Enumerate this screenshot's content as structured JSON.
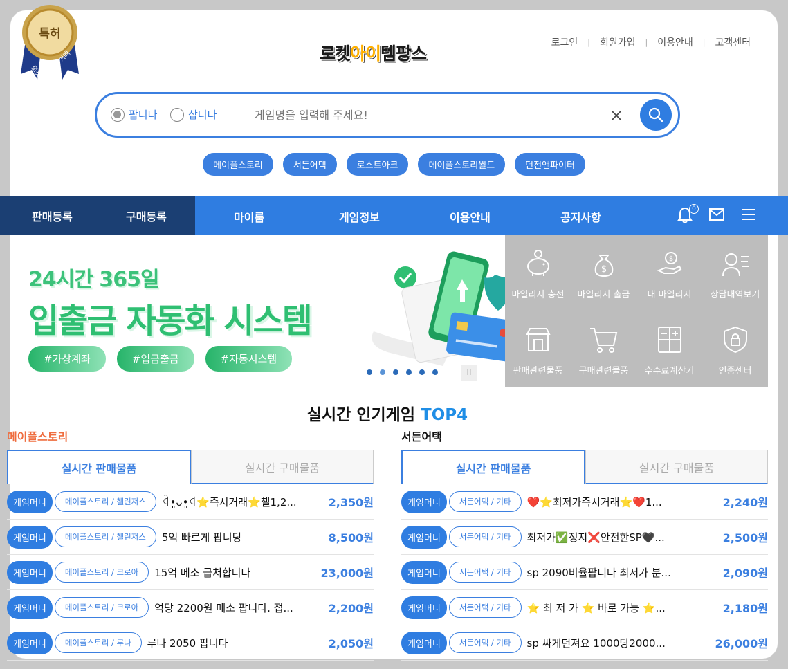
{
  "badge": {
    "title": "특허",
    "ribbon_left": "로켓",
    "ribbon_right": "거래"
  },
  "logo": {
    "main": "로켓",
    "accent": "아이",
    "rest": "템팡스"
  },
  "top_links": [
    "로그인",
    "회원가입",
    "이용안내",
    "고객센터"
  ],
  "search": {
    "radio_sell": "팝니다",
    "radio_buy": "삽니다",
    "placeholder": "게임명을 입력해 주세요!"
  },
  "chips": [
    "메이플스토리",
    "서든어택",
    "로스트아크",
    "메이플스토리월드",
    "던전앤파이터"
  ],
  "nav": {
    "sell_register": "판매등록",
    "buy_register": "구매등록",
    "items": [
      "마이룸",
      "게임정보",
      "이용안내",
      "공지사항"
    ],
    "bell_count": "0"
  },
  "banner": {
    "line1": "24시간 365일",
    "line2": "입출금 자동화 시스템",
    "tags": [
      "#가상계좌",
      "#입금출금",
      "#자동시스템"
    ],
    "pause": "II"
  },
  "quick_menu": [
    {
      "label": "마일리지 충전",
      "icon": "piggy-bank-icon"
    },
    {
      "label": "마일리지 출금",
      "icon": "money-bag-icon"
    },
    {
      "label": "내 마일리지",
      "icon": "coin-hand-icon"
    },
    {
      "label": "상담내역보기",
      "icon": "headset-icon"
    },
    {
      "label": "판매관련물품",
      "icon": "store-icon"
    },
    {
      "label": "구매관련물품",
      "icon": "cart-icon"
    },
    {
      "label": "수수료계산기",
      "icon": "calculator-icon"
    },
    {
      "label": "인증센터",
      "icon": "shield-lock-icon"
    }
  ],
  "realtime": {
    "title": "실시간 인기게임",
    "highlight": "TOP4"
  },
  "columns": [
    {
      "game": "메이플스토리",
      "tab_active": "실시간 판매물품",
      "tab_inactive": "실시간 구매물품",
      "rows": [
        {
          "type": "게임머니",
          "server": "메이플스토리 / 챌린저스",
          "title": "ꒈ•͈ᴗ•͈ꒉ⭐즉시거래⭐챌1,2...",
          "price": "2,350원"
        },
        {
          "type": "게임머니",
          "server": "메이플스토리 / 챌린저스",
          "title": "5억 빠르게 팝니당",
          "price": "8,500원"
        },
        {
          "type": "게임머니",
          "server": "메이플스토리 / 크로아",
          "title": "15억 메소 급처합니다",
          "price": "23,000원"
        },
        {
          "type": "게임머니",
          "server": "메이플스토리 / 크로아",
          "title": "억당 2200원 메소 팝니다. 접...",
          "price": "2,200원"
        },
        {
          "type": "게임머니",
          "server": "메이플스토리 / 루나",
          "title": "루나 2050 팝니다",
          "price": "2,050원"
        }
      ]
    },
    {
      "game": "서든어택",
      "tab_active": "실시간 판매물품",
      "tab_inactive": "실시간 구매물품",
      "rows": [
        {
          "type": "게임머니",
          "server": "서든어택 / 기타",
          "title": "❤️⭐최저가즉시거래⭐❤️1...",
          "price": "2,240원"
        },
        {
          "type": "게임머니",
          "server": "서든어택 / 기타",
          "title": "최저가✅정지❌안전한SP🖤...",
          "price": "2,500원"
        },
        {
          "type": "게임머니",
          "server": "서든어택 / 기타",
          "title": "sp 2090비율팝니다 최저가 분...",
          "price": "2,090원"
        },
        {
          "type": "게임머니",
          "server": "서든어택 / 기타",
          "title": "⭐ 최 저 가 ⭐ 바로 가능 ⭐...",
          "price": "2,180원"
        },
        {
          "type": "게임머니",
          "server": "서든어택 / 기타",
          "title": "sp 싸게던져요 1000당2000...",
          "price": "26,000원"
        }
      ]
    }
  ]
}
